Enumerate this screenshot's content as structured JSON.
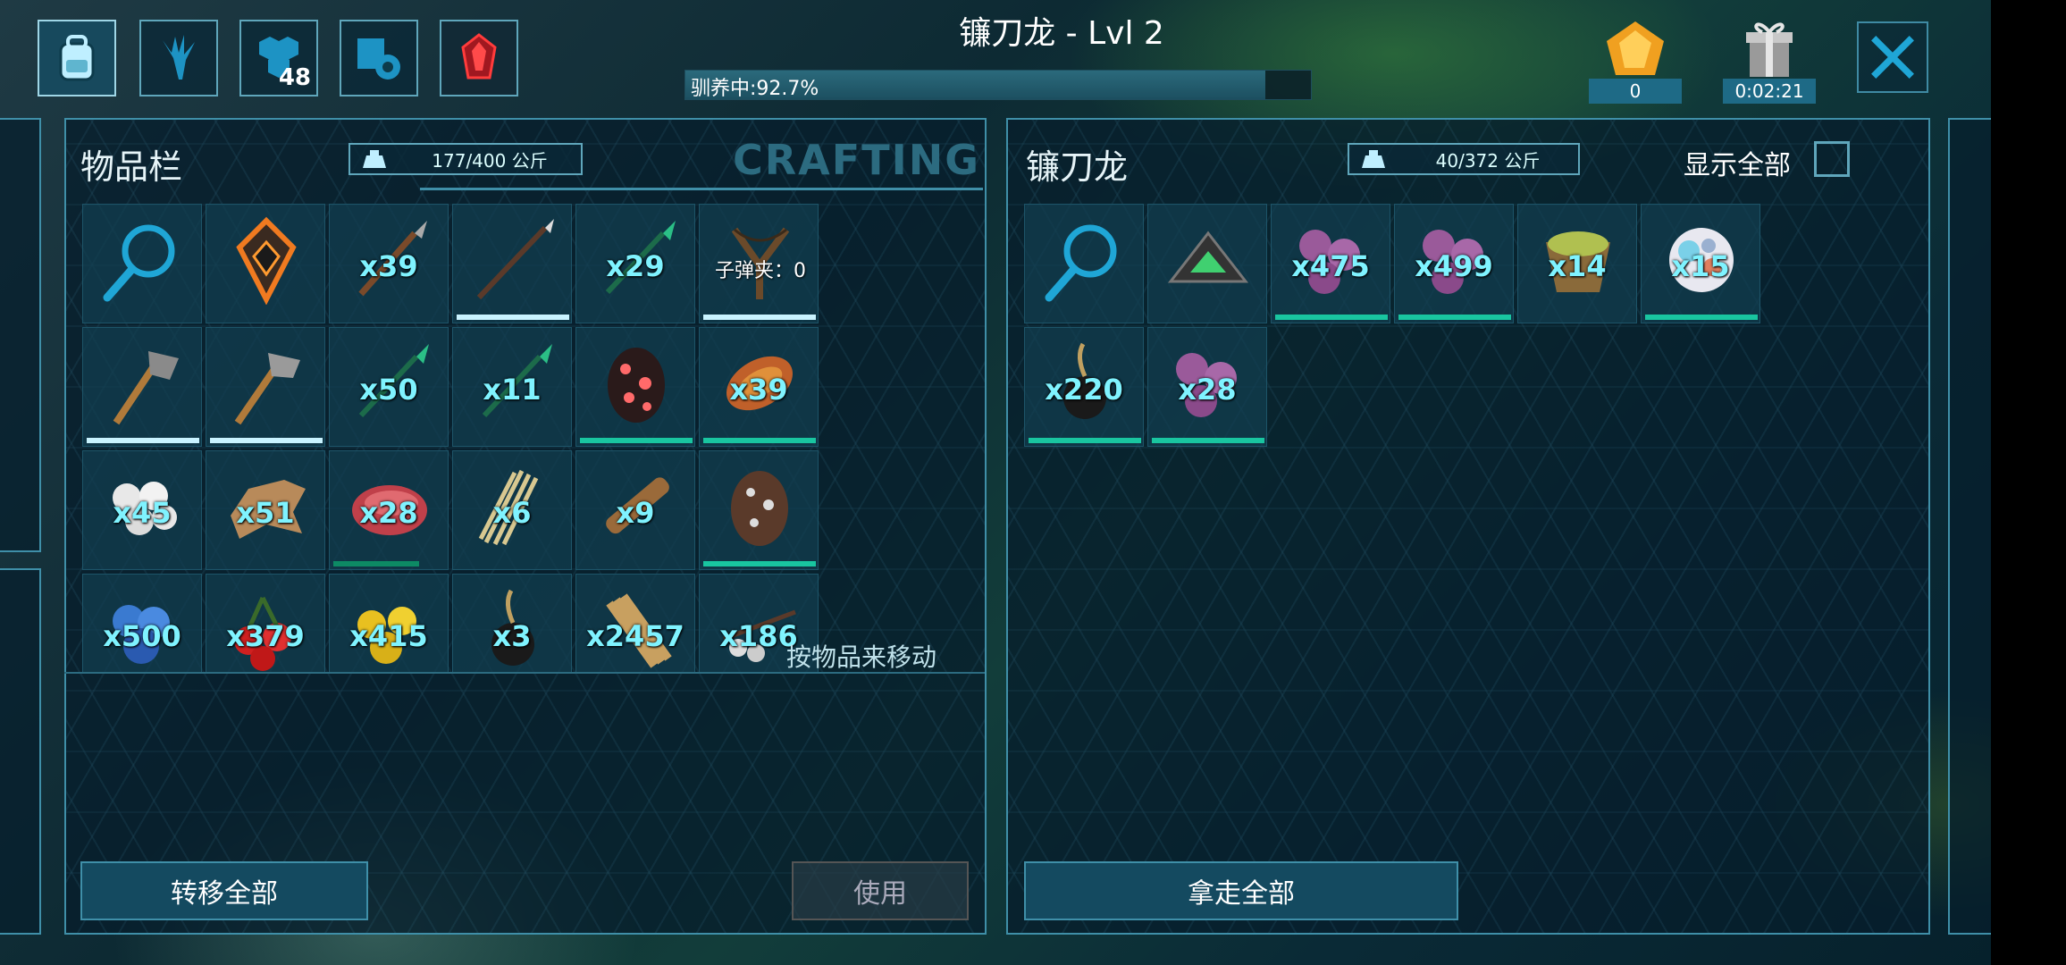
{
  "header": {
    "title": "镰刀龙 - Lvl 2",
    "taming_label": "驯养中:92.7%",
    "taming_progress": 0.927,
    "engram_count": "48",
    "resource_amber": "0",
    "timer": "0:02:21"
  },
  "top_icons": [
    "backpack-icon",
    "tame-claw-icon",
    "engram-hex-icon",
    "settings-book-icon",
    "tek-crystal-icon"
  ],
  "left_panel": {
    "title": "物品栏",
    "weight": "177/400 公斤",
    "crafting_tab": "CRAFTING",
    "hint": "按物品来移动",
    "transfer_all": "转移全部",
    "use": "使用",
    "slots": [
      {
        "icon": "search-icon",
        "qty": "",
        "bar": null
      },
      {
        "icon": "implant-icon",
        "qty": "",
        "bar": null
      },
      {
        "icon": "spear-icon",
        "qty": "x39",
        "bar": null
      },
      {
        "icon": "pike-icon",
        "qty": "",
        "bar": "white"
      },
      {
        "icon": "tranq-arrow-icon",
        "qty": "x29",
        "bar": null
      },
      {
        "icon": "slingshot-icon",
        "qty": "",
        "ammo": "子弹夹：0",
        "bar": "white"
      },
      {
        "icon": "stone-hatchet-icon",
        "qty": "",
        "bar": "white"
      },
      {
        "icon": "stone-pick-icon",
        "qty": "",
        "bar": "white"
      },
      {
        "icon": "tranq-arrow-icon",
        "qty": "x50",
        "bar": null
      },
      {
        "icon": "tranq-arrow-icon",
        "qty": "x11",
        "bar": null
      },
      {
        "icon": "spotted-egg-red-icon",
        "qty": "",
        "bar": "green"
      },
      {
        "icon": "cooked-meat-icon",
        "qty": "x39",
        "bar": "green"
      },
      {
        "icon": "pearls-icon",
        "qty": "x45",
        "bar": null
      },
      {
        "icon": "hide-icon",
        "qty": "x51",
        "bar": null
      },
      {
        "icon": "raw-meat-icon",
        "qty": "x28",
        "bar": "dkgreen"
      },
      {
        "icon": "fiber-icon",
        "qty": "x6",
        "bar": null
      },
      {
        "icon": "wood-icon",
        "qty": "x9",
        "bar": null
      },
      {
        "icon": "spotted-egg-brown-icon",
        "qty": "",
        "bar": "green"
      },
      {
        "icon": "azulberry-icon",
        "qty": "x500",
        "bar": null
      },
      {
        "icon": "tintoberry-icon",
        "qty": "x379",
        "bar": null
      },
      {
        "icon": "amarberry-icon",
        "qty": "x415",
        "bar": null
      },
      {
        "icon": "narcoberry-icon",
        "qty": "x3",
        "bar": null
      },
      {
        "icon": "thatch-icon",
        "qty": "x2457",
        "bar": null
      },
      {
        "icon": "stimberry-icon",
        "qty": "x186",
        "bar": null
      }
    ]
  },
  "right_panel": {
    "title": "镰刀龙",
    "weight": "40/372 公斤",
    "show_all": "显示全部",
    "take_all": "拿走全部",
    "slots": [
      {
        "icon": "search-icon",
        "qty": "",
        "bar": null
      },
      {
        "icon": "saddle-icon",
        "qty": "",
        "bar": null
      },
      {
        "icon": "mejoberry-icon",
        "qty": "x475",
        "bar": "green"
      },
      {
        "icon": "mejoberry-icon",
        "qty": "x499",
        "bar": "green"
      },
      {
        "icon": "fertilizer-icon",
        "qty": "x14",
        "bar": null
      },
      {
        "icon": "fungus-icon",
        "qty": "x15",
        "bar": "green"
      },
      {
        "icon": "narcoberry-icon",
        "qty": "x220",
        "bar": "green"
      },
      {
        "icon": "mejoberry-icon",
        "qty": "x28",
        "bar": "green"
      }
    ]
  },
  "colors": {
    "accent": "#3f8fa8",
    "qty": "#7ff3ff",
    "bar_green": "#19c5a0",
    "bar_white": "#c9f3ff"
  }
}
